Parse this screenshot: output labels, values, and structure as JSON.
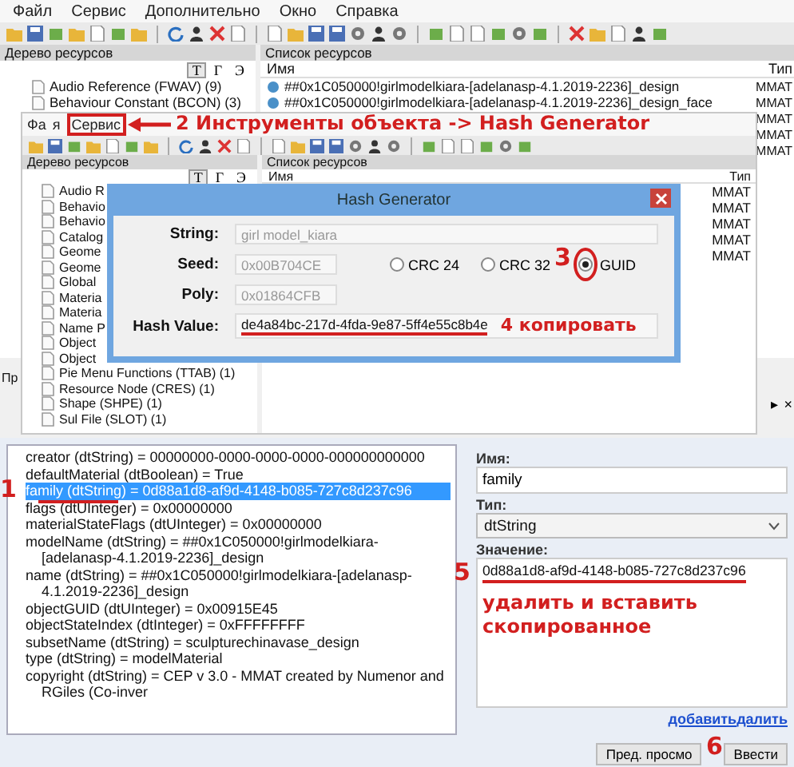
{
  "back_window": {
    "menu": [
      "Файл",
      "Сервис",
      "Дополнительно",
      "Окно",
      "Справка"
    ],
    "tree_title": "Дерево ресурсов",
    "view_buttons": [
      "T",
      "Г",
      "Э"
    ],
    "tree_items": [
      "Audio Reference (FWAV) (9)",
      "Behaviour Constant (BCON) (3)"
    ],
    "list_title": "Список ресурсов",
    "columns": [
      "Имя",
      "Тип"
    ],
    "rows": [
      {
        "name": "##0x1C050000!girlmodelkiara-[adelanasp-4.1.2019-2236]_design",
        "type": "MMAT"
      },
      {
        "name": "##0x1C050000!girlmodelkiara-[adelanasp-4.1.2019-2236]_design_face",
        "type": "MMAT"
      },
      {
        "type": "MMAT"
      },
      {
        "type": "MMAT"
      },
      {
        "type": "MMAT"
      }
    ],
    "panel_title": "Пр",
    "panel_controls": [
      "▸",
      "×"
    ]
  },
  "front_window": {
    "menu": [
      "Фа",
      "я",
      "Сервис"
    ],
    "tree_title": "Дерево ресурсов",
    "view_buttons": [
      "T",
      "Г",
      "Э"
    ],
    "tree_items": [
      "Audio R",
      "Behavio",
      "Behavio",
      "Catalog",
      "Geome",
      "Geome",
      "Global",
      "Materia",
      "Materia",
      "Name P",
      "Object",
      "Object",
      "Pie Menu Functions (TTAB) (1)",
      "Resource Node (CRES) (1)",
      "Shape (SHPE) (1)",
      "Sul File (SLOT) (1)"
    ],
    "list_title": "Список ресурсов",
    "columns": [
      "Имя",
      "Тип"
    ],
    "rows": [
      {
        "type": "MMAT"
      },
      {
        "type": "MMAT"
      },
      {
        "type": "MMAT"
      },
      {
        "type": "MMAT"
      },
      {
        "type": "MMAT"
      }
    ]
  },
  "dialog": {
    "title": "Hash Generator",
    "string_label": "String:",
    "string_value": "girl model_kiara",
    "string_disabled": true,
    "seed_label": "Seed:",
    "seed_value": "0x00B704CE",
    "poly_label": "Poly:",
    "poly_value": "0x01864CFB",
    "options": [
      {
        "label": "CRC 24",
        "selected": false
      },
      {
        "label": "CRC 32",
        "selected": false
      },
      {
        "label": "GUID",
        "selected": true
      }
    ],
    "hash_label": "Hash Value:",
    "hash_value": "de4a84bc-217d-4fda-9e87-5ff4e55c8b4e"
  },
  "properties": {
    "items": [
      {
        "text": "creator (dtString) = 00000000-0000-0000-0000-000000000000",
        "selected": false
      },
      {
        "text": "defaultMaterial (dtBoolean) = True",
        "selected": false
      },
      {
        "text": "family (dtString) = 0d88a1d8-af9d-4148-b085-727c8d237c96",
        "selected": true
      },
      {
        "text": "flags (dtUInteger) = 0x00000000",
        "selected": false
      },
      {
        "text": "materialStateFlags (dtUInteger) = 0x00000000",
        "selected": false
      },
      {
        "text": "modelName (dtString) = ##0x1C050000!girlmodelkiara-[adelanasp-4.1.2019-2236]_design",
        "selected": false
      },
      {
        "text": "name (dtString) = ##0x1C050000!girlmodelkiara-[adelanasp-4.1.2019-2236]_design",
        "selected": false
      },
      {
        "text": "objectGUID (dtUInteger) = 0x00915E45",
        "selected": false
      },
      {
        "text": "objectStateIndex (dtInteger) = 0xFFFFFFFF",
        "selected": false
      },
      {
        "text": "subsetName (dtString) = sculpturechinavase_design",
        "selected": false
      },
      {
        "text": "type (dtString) = modelMaterial",
        "selected": false
      },
      {
        "text": "copyright (dtString) = CEP v 3.0 - MMAT created by Numenor and RGiles (Co-inver",
        "selected": false
      }
    ],
    "name_label": "Имя:",
    "name_value": "family",
    "type_label": "Тип:",
    "type_value": "dtString",
    "value_label": "Значение:",
    "value": "0d88a1d8-af9d-4148-b085-727c8d237c96",
    "links": [
      "добавить",
      "далить"
    ],
    "buttons": [
      "Пред. просмо",
      "Ввести"
    ]
  },
  "annotations": [
    {
      "kind": "step",
      "text": "1"
    },
    {
      "kind": "note",
      "text": "2 Инструменты объекта -> Hash Generator"
    },
    {
      "kind": "step",
      "text": "3"
    },
    {
      "kind": "note",
      "text": "4 копировать"
    },
    {
      "kind": "step",
      "text": "5"
    },
    {
      "kind": "note",
      "text": "удалить и вставить скопированное"
    },
    {
      "kind": "step",
      "text": "6"
    }
  ]
}
